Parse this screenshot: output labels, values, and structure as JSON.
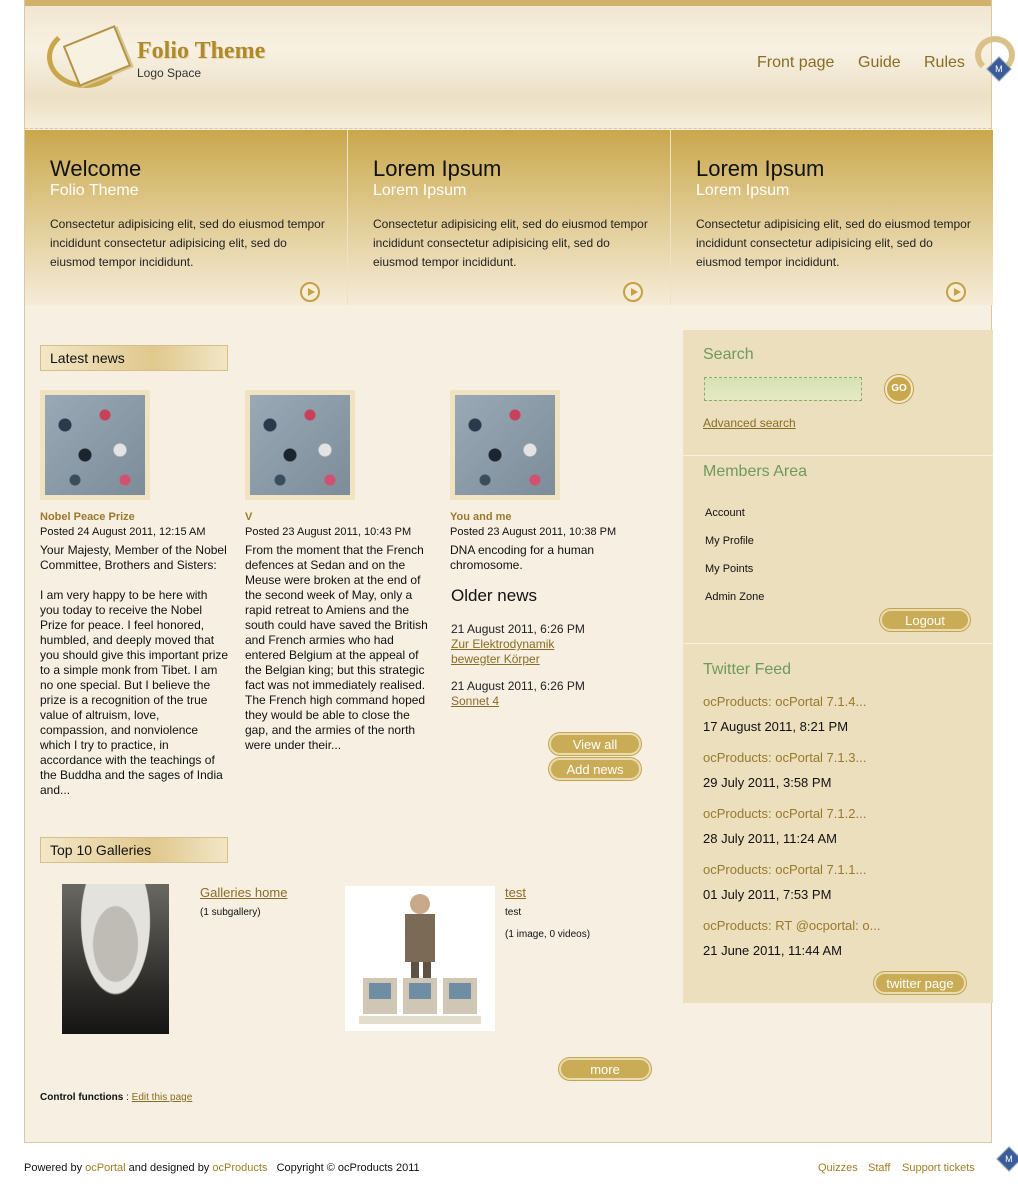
{
  "header": {
    "logo_title": "Folio Theme",
    "logo_sub": "Logo Space",
    "nav": [
      "Front page",
      "Guide",
      "Rules"
    ]
  },
  "banner": [
    {
      "title": "Welcome",
      "subtitle": "Folio Theme",
      "text": "Consectetur adipisicing elit, sed do eiusmod tempor incididunt consectetur adipisicing elit, sed do eiusmod tempor incididunt."
    },
    {
      "title": "Lorem Ipsum",
      "subtitle": "Lorem Ipsum",
      "text": "Consectetur adipisicing elit, sed do eiusmod tempor incididunt consectetur adipisicing elit, sed do eiusmod tempor incididunt."
    },
    {
      "title": "Lorem Ipsum",
      "subtitle": "Lorem Ipsum",
      "text": "Consectetur adipisicing elit, sed do eiusmod tempor incididunt consectetur adipisicing elit, sed do eiusmod tempor incididunt."
    }
  ],
  "latest_news": {
    "heading": "Latest news",
    "items": [
      {
        "title": "Nobel Peace Prize",
        "date": "Posted 24 August 2011, 12:15 AM",
        "body": "Your Majesty, Member of the Nobel Committee, Brothers and Sisters:\n\nI am very happy to be here with you today to receive the Nobel Prize for peace. I feel honored, humbled, and deeply moved that you should give this important prize to a simple monk from Tibet. I am no one special. But I believe the prize is a recognition of the true value of altruism, love, compassion, and nonviolence which I try to practice, in accordance with the teachings of the Buddha and the sages of India and..."
      },
      {
        "title": "V",
        "date": "Posted 23 August 2011, 10:43 PM",
        "body": "From the moment that the French defences at Sedan and on the Meuse were broken at the end of the second week of May, only a rapid retreat to Amiens and the south could have saved the British and French armies who had entered Belgium at the appeal of the Belgian king; but this strategic fact was not immediately realised. The French high command hoped they would be able to close the gap, and the armies of the north were under their..."
      },
      {
        "title": "You and me",
        "date": "Posted 23 August 2011, 10:38 PM",
        "body": "DNA encoding for a human chromosome."
      }
    ],
    "older_heading": "Older news",
    "older": [
      {
        "date": "21 August 2011, 6:26 PM",
        "link_line1": "Zur Elektrodynamik",
        "link_line2": "bewegter Körper"
      },
      {
        "date": "21 August 2011, 6:26 PM",
        "link_line1": "Sonnet 4",
        "link_line2": ""
      }
    ],
    "view_all": "View all",
    "add_news": "Add news"
  },
  "galleries": {
    "heading": "Top 10 Galleries",
    "items": [
      {
        "name": "Galleries home",
        "desc": "",
        "count": "(1 subgallery)"
      },
      {
        "name": "test",
        "desc": "test",
        "count": "(1 image, 0 videos)"
      }
    ],
    "more": "more"
  },
  "control": {
    "label": "Control functions",
    "sep": " : ",
    "link": "Edit this page"
  },
  "sidebar": {
    "search": {
      "heading": "Search",
      "go": "GO",
      "advanced": "Advanced search",
      "value": ""
    },
    "members": {
      "heading": "Members Area",
      "items": [
        "Account",
        "My Profile",
        "My Points",
        "Admin Zone"
      ],
      "logout": "Logout"
    },
    "twitter": {
      "heading": "Twitter Feed",
      "items": [
        {
          "text": "ocProducts: ocPortal 7.1.4...",
          "date": "17 August 2011, 8:21 PM"
        },
        {
          "text": "ocProducts: ocPortal 7.1.3...",
          "date": "29 July 2011, 3:58 PM"
        },
        {
          "text": "ocProducts: ocPortal 7.1.2...",
          "date": "28 July 2011, 11:24 AM"
        },
        {
          "text": "ocProducts: ocPortal 7.1.1...",
          "date": "01 July 2011, 7:53 PM"
        },
        {
          "text": "ocProducts: RT @ocportal: o...",
          "date": "21 June 2011, 11:44 AM"
        }
      ],
      "page_button": "twitter page"
    }
  },
  "footer": {
    "powered": "Powered by",
    "ocportal": "ocPortal",
    "designed": "and designed by",
    "ocproducts": "ocProducts",
    "copyright": "Copyright © ocProducts 2011",
    "links": [
      "Quizzes",
      "Staff",
      "Support tickets"
    ]
  },
  "badge_letter": "M",
  "colors": {
    "accent": "#c9ac55",
    "link": "#8a6d24",
    "sidebar_heading": "#6f9a5c",
    "background": "#f7efe2"
  }
}
